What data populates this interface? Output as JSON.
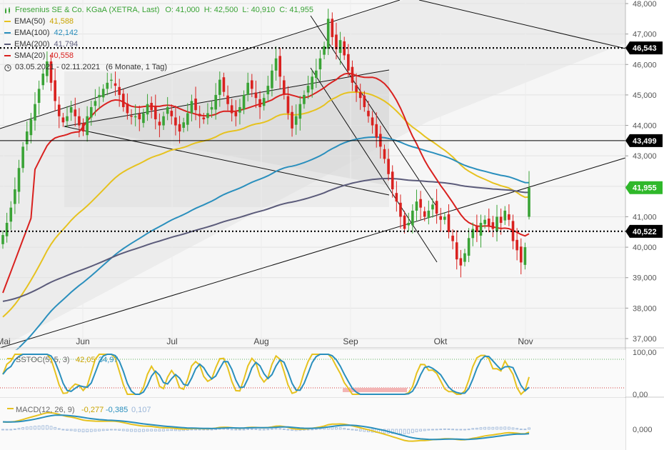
{
  "legend": {
    "title_row": {
      "label": "Fresenius SE & Co. KGaA (XETRA, Last)",
      "o": "O: 41,000",
      "h": "H: 42,500",
      "l": "L: 40,910",
      "c": "C: 41,955"
    },
    "items": [
      {
        "label": "EMA(50)",
        "value": "41,588",
        "color": "#e6c21f"
      },
      {
        "label": "EMA(100)",
        "value": "42,142",
        "color": "#2a8fbd"
      },
      {
        "label": "EMA(200)",
        "value": "41,794",
        "color": "#5b5b7a"
      },
      {
        "label": "SMA(20)",
        "value": "40,558",
        "color": "#d9211f"
      }
    ],
    "range": {
      "label": "03.05.2021 - 02.11.2021",
      "detail": "(6 Monate, 1 Tag)"
    }
  },
  "colors": {
    "up": "#3aa336",
    "down": "#d9211f",
    "tag_green": "#2fb82a",
    "tag_black": "#000000"
  },
  "icons": [
    "candle-chart-icon",
    "clock-icon"
  ],
  "chart_data": [
    {
      "type": "candlestick",
      "title": "Fresenius SE & Co. KGaA (XETRA, Last)",
      "x_tick_labels": [
        "Mai",
        "Jun",
        "Jul",
        "Aug",
        "Sep",
        "Okt",
        "Nov"
      ],
      "y_tick_labels": [
        "48,000",
        "47,000",
        "46,000",
        "45,000",
        "44,000",
        "43,000",
        "42,000",
        "41,000",
        "40,000",
        "39,000",
        "38,000",
        "37,000"
      ],
      "ylim": [
        37.0,
        48.0
      ],
      "price_tags": [
        {
          "label": "46,543",
          "value": 46.543,
          "style": "black"
        },
        {
          "label": "43,499",
          "value": 43.499,
          "style": "black"
        },
        {
          "label": "41,955",
          "value": 41.955,
          "style": "green"
        },
        {
          "label": "40,522",
          "value": 40.522,
          "style": "black"
        }
      ],
      "horizontal_lines": [
        {
          "value": 46.543,
          "style": "dotted"
        },
        {
          "value": 43.499,
          "style": "solid"
        },
        {
          "value": 40.522,
          "style": "dotted"
        }
      ],
      "ohlc_last": {
        "open": 41.0,
        "high": 42.5,
        "low": 40.91,
        "close": 41.955
      },
      "close_estimates": [
        40.4,
        40.8,
        41.3,
        41.9,
        42.6,
        43.3,
        43.8,
        44.2,
        44.7,
        45.2,
        45.7,
        46.1,
        45.4,
        44.8,
        44.3,
        44.1,
        44.3,
        44.6,
        44.3,
        44.0,
        43.8,
        44.3,
        44.6,
        44.8,
        45.0,
        45.2,
        45.4,
        45.5,
        45.3,
        45.0,
        44.6,
        44.4,
        44.3,
        44.3,
        44.2,
        44.4,
        44.7,
        44.5,
        44.2,
        44.0,
        44.3,
        44.6,
        44.3,
        44.0,
        43.8,
        44.1,
        44.4,
        44.8,
        44.5,
        44.3,
        44.2,
        44.4,
        44.6,
        45.0,
        45.5,
        45.1,
        44.7,
        44.4,
        44.3,
        44.6,
        45.0,
        45.4,
        45.2,
        44.9,
        44.6,
        44.9,
        45.3,
        45.8,
        46.2,
        45.6,
        45.0,
        44.4,
        43.9,
        44.3,
        44.7,
        45.0,
        45.3,
        45.6,
        45.8,
        46.2,
        46.6,
        47.5,
        46.9,
        46.5,
        46.8,
        46.3,
        45.8,
        45.4,
        45.1,
        44.9,
        44.6,
        44.3,
        44.0,
        43.6,
        43.3,
        42.9,
        42.4,
        41.9,
        41.5,
        41.0,
        40.6,
        40.8,
        41.2,
        41.5,
        41.3,
        41.0,
        41.2,
        41.4,
        41.1,
        40.9,
        41.0,
        40.5,
        40.2,
        39.6,
        39.4,
        39.8,
        40.3,
        40.6,
        40.5,
        40.8,
        40.9,
        40.7,
        40.6,
        41.0,
        40.8,
        41.2,
        40.9,
        40.2,
        39.9,
        39.5,
        40.0,
        41.955
      ],
      "overlays": [
        {
          "name": "EMA(50)",
          "last": 41.588
        },
        {
          "name": "EMA(100)",
          "last": 42.142
        },
        {
          "name": "EMA(200)",
          "last": 41.794
        },
        {
          "name": "SMA(20)",
          "last": 40.558
        }
      ]
    },
    {
      "type": "line",
      "title": "SSTOC(5, 5, 3)",
      "series": [
        {
          "name": "SSTOC",
          "last": 42.05,
          "color": "#e6c21f"
        },
        {
          "name": "Signal",
          "last": 34.97,
          "color": "#2a8fbd"
        }
      ],
      "last_values": [
        "42,05",
        "34,97"
      ],
      "y_tick_labels": [
        "100,00",
        "0,00"
      ],
      "ylim": [
        0,
        100
      ]
    },
    {
      "type": "line",
      "title": "MACD(12, 26, 9)",
      "series": [
        {
          "name": "MACD",
          "last": -0.277,
          "color": "#e6c21f"
        },
        {
          "name": "Signal",
          "last": -0.385,
          "color": "#2a8fbd"
        },
        {
          "name": "Histogram",
          "last": 0.107,
          "color": "#9bb6d9"
        }
      ],
      "last_values": [
        "-0,277",
        "-0,385",
        "0,107"
      ],
      "y_tick_labels": [
        "0,000"
      ]
    }
  ]
}
